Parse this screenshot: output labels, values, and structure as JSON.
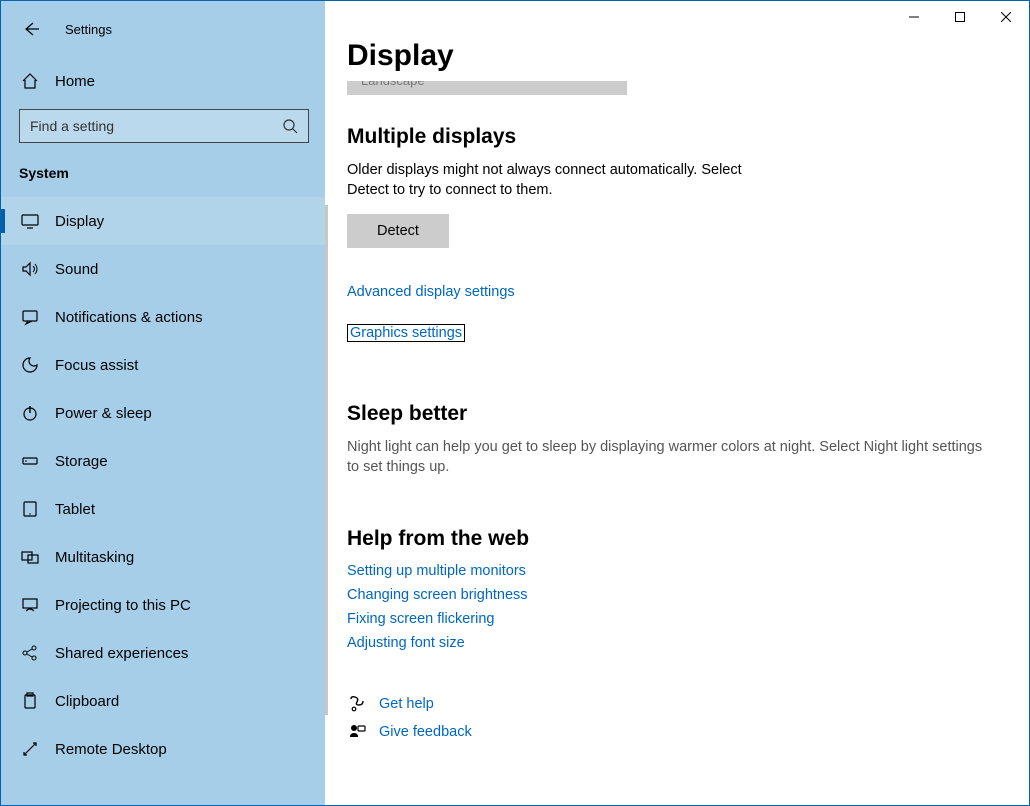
{
  "titlebar": {
    "app_name": "Settings"
  },
  "sidebar": {
    "home_label": "Home",
    "search_placeholder": "Find a setting",
    "category": "System",
    "items": [
      {
        "label": "Display",
        "icon": "display-icon",
        "selected": true
      },
      {
        "label": "Sound",
        "icon": "sound-icon"
      },
      {
        "label": "Notifications & actions",
        "icon": "notifications-icon"
      },
      {
        "label": "Focus assist",
        "icon": "focus-assist-icon"
      },
      {
        "label": "Power & sleep",
        "icon": "power-icon"
      },
      {
        "label": "Storage",
        "icon": "storage-icon"
      },
      {
        "label": "Tablet",
        "icon": "tablet-icon"
      },
      {
        "label": "Multitasking",
        "icon": "multitasking-icon"
      },
      {
        "label": "Projecting to this PC",
        "icon": "projecting-icon"
      },
      {
        "label": "Shared experiences",
        "icon": "shared-icon"
      },
      {
        "label": "Clipboard",
        "icon": "clipboard-icon"
      },
      {
        "label": "Remote Desktop",
        "icon": "remote-desktop-icon"
      }
    ]
  },
  "main": {
    "title": "Display",
    "dropdown_value": "Landscape",
    "section_multiple": {
      "heading": "Multiple displays",
      "desc": "Older displays might not always connect automatically. Select Detect to try to connect to them.",
      "button": "Detect",
      "link_advanced": "Advanced display settings",
      "link_graphics": "Graphics settings"
    },
    "section_sleep": {
      "heading": "Sleep better",
      "desc": "Night light can help you get to sleep by displaying warmer colors at night. Select Night light settings to set things up."
    },
    "section_help": {
      "heading": "Help from the web",
      "links": [
        "Setting up multiple monitors",
        "Changing screen brightness",
        "Fixing screen flickering",
        "Adjusting font size"
      ]
    },
    "footer": {
      "get_help": "Get help",
      "give_feedback": "Give feedback"
    }
  }
}
